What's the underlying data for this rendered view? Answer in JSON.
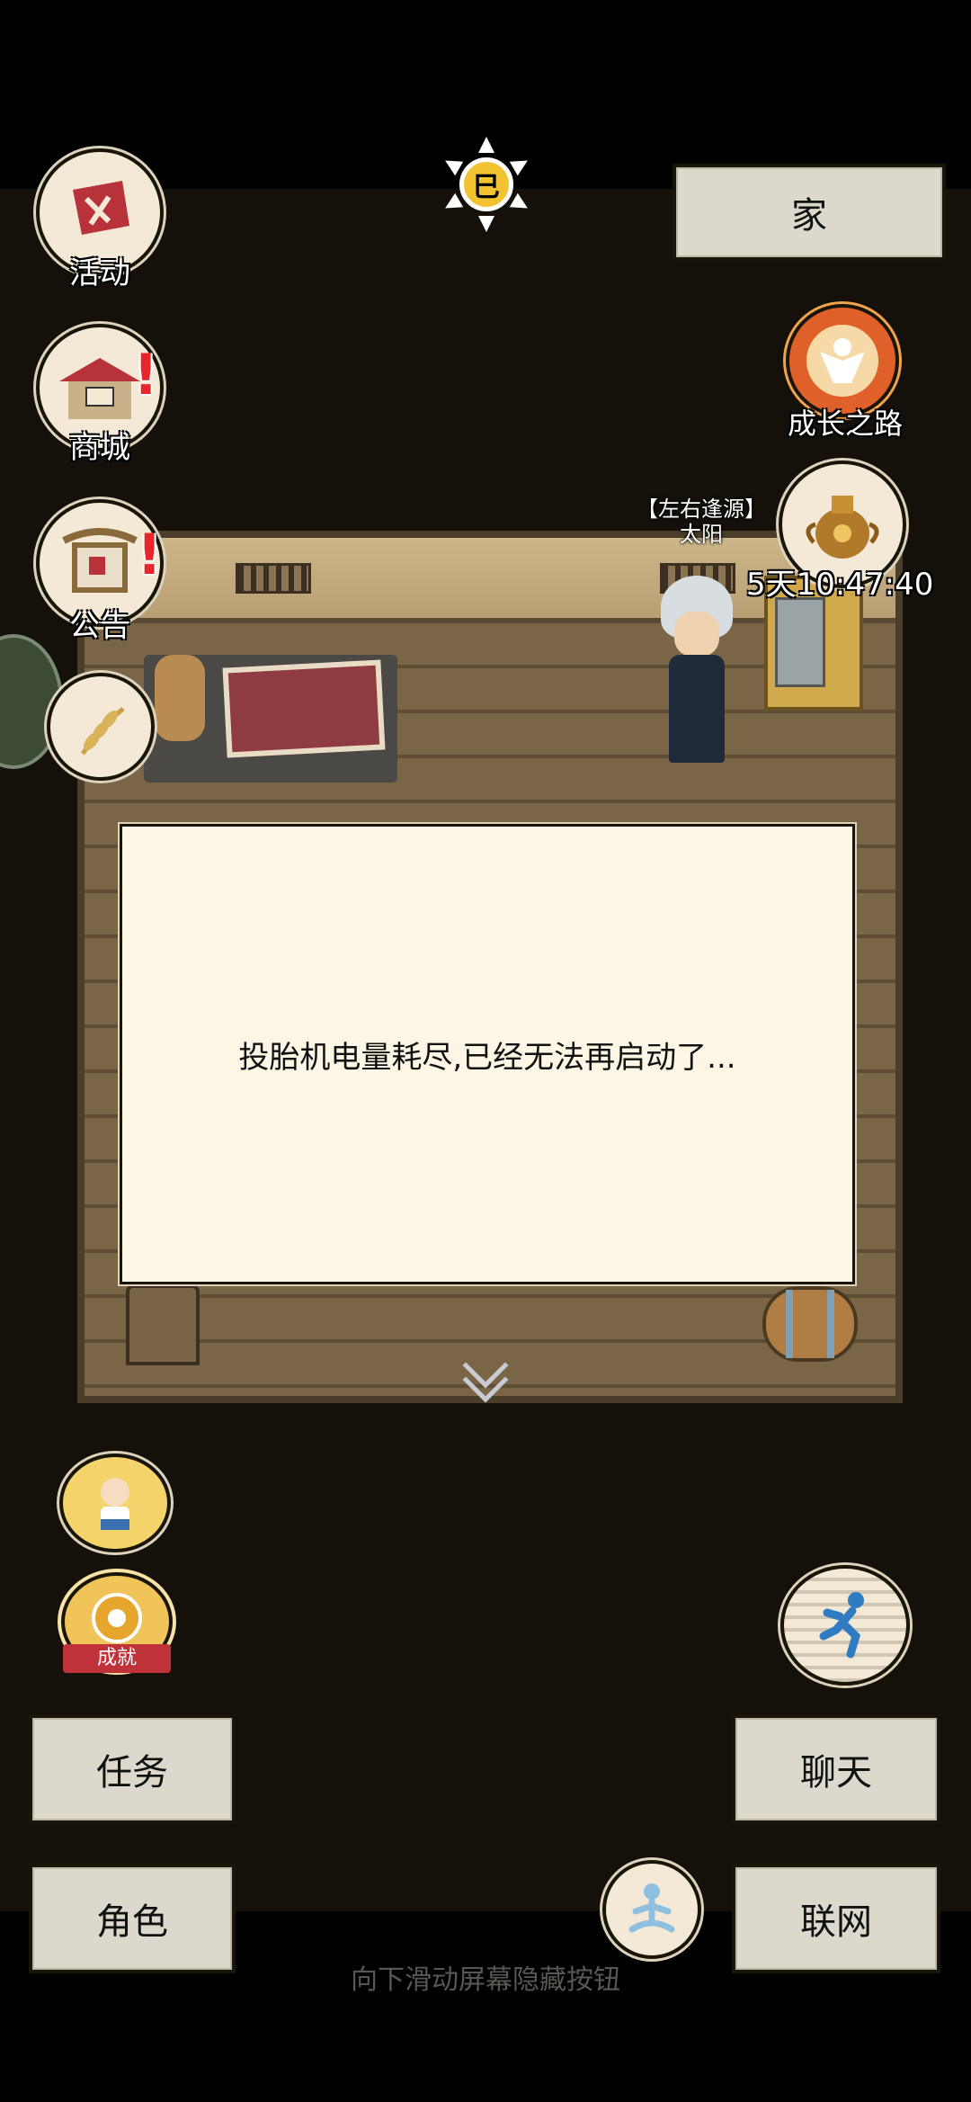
{
  "top": {
    "time_icon_glyph": "巳"
  },
  "left_menu": {
    "activity": {
      "label": "活动",
      "icon": "flag-scroll-icon"
    },
    "shop": {
      "label": "商城",
      "icon": "shop-stall-icon",
      "alert": "!"
    },
    "notice": {
      "label": "公告",
      "icon": "notice-board-icon",
      "alert": "!"
    }
  },
  "right_menu": {
    "home_label": "家",
    "growth": {
      "label": "成长之路",
      "icon": "growth-figure-icon"
    },
    "event_timer": "5天10:47:40"
  },
  "character": {
    "title": "【左右逢源】",
    "name": "太阳"
  },
  "dialog": {
    "message": "投胎机电量耗尽,已经无法再启动了..."
  },
  "bottom_left": {
    "achievement_ribbon": "成就",
    "task_label": "任务",
    "role_label": "角色"
  },
  "bottom_right": {
    "chat_label": "聊天",
    "network_label": "联网"
  },
  "hint_text": "向下滑动屏幕隐藏按钮",
  "colors": {
    "field_bg": "#15110a",
    "dialog_bg": "#fdf6e4",
    "button_bg": "#ddd8cc",
    "alert_red": "#e8262a",
    "sun_gold": "#f2c230"
  }
}
